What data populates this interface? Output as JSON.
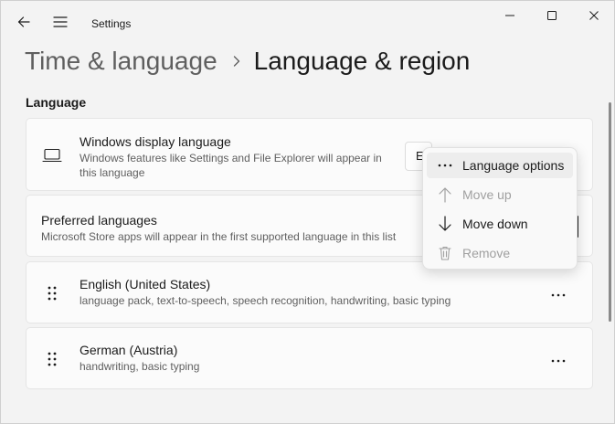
{
  "window": {
    "app_title": "Settings",
    "accent_color": "#1b1b1b"
  },
  "breadcrumb": {
    "parent": "Time & language",
    "current": "Language & region"
  },
  "section": {
    "label": "Language"
  },
  "display_language": {
    "title": "Windows display language",
    "description": "Windows features like Settings and File Explorer will appear in this language",
    "selected_value": "E",
    "icon": "laptop-icon"
  },
  "preferred_languages": {
    "title": "Preferred languages",
    "description": "Microsoft Store apps will appear in the first supported language in this list"
  },
  "languages": [
    {
      "name": "English (United States)",
      "features": "language pack, text-to-speech, speech recognition, handwriting, basic typing",
      "icon": "drag-handle-icon",
      "more_icon": "more-options-icon"
    },
    {
      "name": "German (Austria)",
      "features": "handwriting, basic typing",
      "icon": "drag-handle-icon",
      "more_icon": "more-options-icon"
    }
  ],
  "context_menu": {
    "items": [
      {
        "label": "Language options",
        "icon": "more-options-icon",
        "enabled": true,
        "highlighted": true
      },
      {
        "label": "Move up",
        "icon": "arrow-up-icon",
        "enabled": false
      },
      {
        "label": "Move down",
        "icon": "arrow-down-icon",
        "enabled": true
      },
      {
        "label": "Remove",
        "icon": "trash-icon",
        "enabled": false
      }
    ]
  }
}
